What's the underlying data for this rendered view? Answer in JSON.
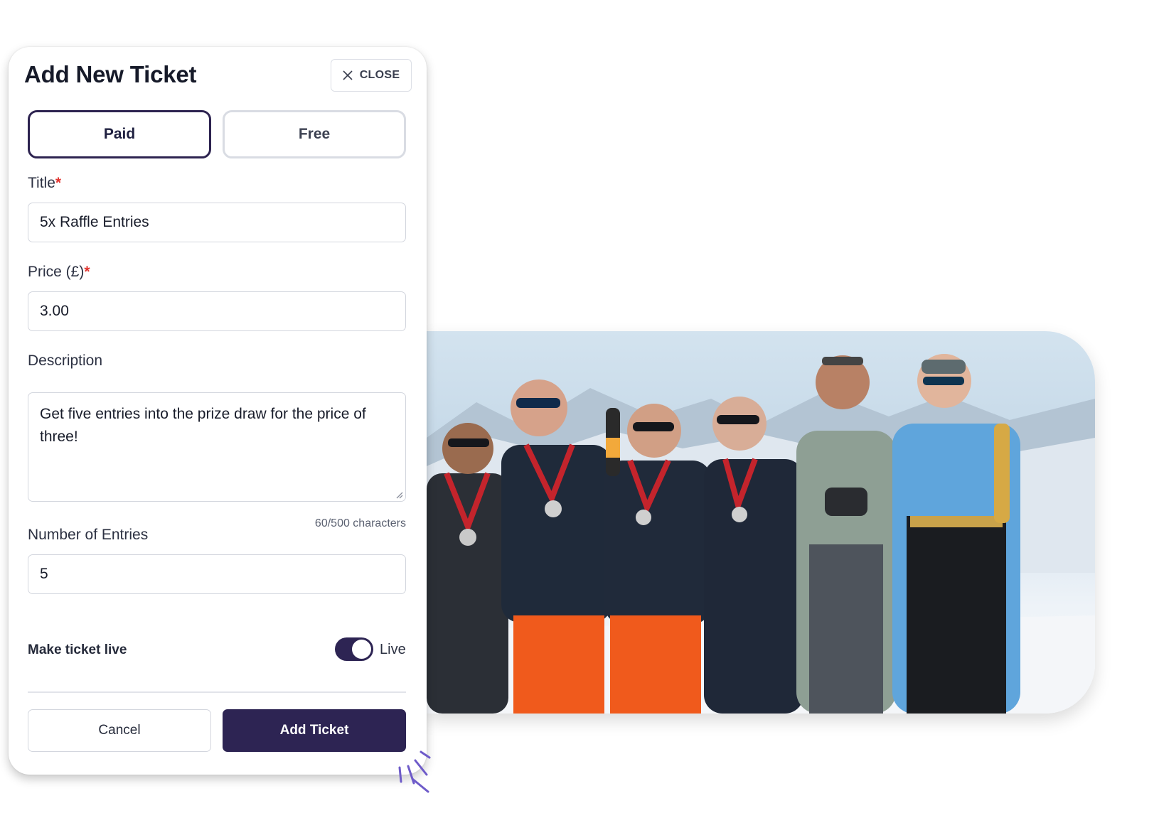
{
  "modal": {
    "title": "Add New Ticket",
    "close_label": "CLOSE",
    "type_options": [
      "Paid",
      "Free"
    ],
    "selected_type": "Paid"
  },
  "form": {
    "title": {
      "label": "Title",
      "value": "5x Raffle Entries"
    },
    "price": {
      "label": "Price (£)",
      "value": "3.00"
    },
    "description": {
      "label": "Description",
      "value": "Get five entries into the prize draw for the price of three!",
      "counter": "60/500 characters"
    },
    "entries": {
      "label": "Number of Entries",
      "value": "5"
    },
    "live": {
      "label": "Make ticket live",
      "state_label": "Live",
      "on": true
    },
    "required_mark": "*"
  },
  "actions": {
    "cancel_label": "Cancel",
    "submit_label": "Add Ticket"
  },
  "colors": {
    "primary": "#2d2453",
    "required": "#e2342f",
    "border": "#d3d6de",
    "sparkle": "#6e5bc9"
  },
  "icons": [
    "close-icon",
    "resize-grip-icon",
    "sparkle-icon"
  ]
}
